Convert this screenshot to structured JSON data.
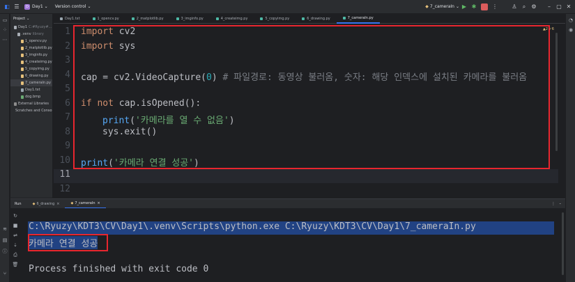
{
  "titlebar": {
    "project_badge": "D",
    "project_name": "Day1",
    "vcs": "Version control",
    "run_config": "7_cameraIn"
  },
  "project_panel": {
    "header": "Project",
    "items": [
      {
        "label": "Day1",
        "note": "C:#Ryuzy#...",
        "indent": 1,
        "icon": "folder-icon"
      },
      {
        "label": ".venv",
        "note": "library",
        "indent": 2,
        "icon": "folder-icon"
      },
      {
        "label": "1_opencv.py",
        "indent": 3,
        "icon": "python-file-icon"
      },
      {
        "label": "2_matplotlib.py",
        "indent": 3,
        "icon": "python-file-icon"
      },
      {
        "label": "3_imginfo.py",
        "indent": 3,
        "icon": "python-file-icon"
      },
      {
        "label": "4_createimg.py",
        "indent": 3,
        "icon": "python-file-icon"
      },
      {
        "label": "5_copyimg.py",
        "indent": 3,
        "icon": "python-file-icon"
      },
      {
        "label": "6_drawing.py",
        "indent": 3,
        "icon": "python-file-icon"
      },
      {
        "label": "7_cameraIn.py",
        "indent": 3,
        "icon": "python-file-icon",
        "selected": true
      },
      {
        "label": "Day1.txt",
        "indent": 3,
        "icon": "text-file-icon"
      },
      {
        "label": "dog.bmp",
        "indent": 3,
        "icon": "image-file-icon"
      },
      {
        "label": "External Libraries",
        "indent": 1,
        "icon": "library-icon"
      },
      {
        "label": "Scratches and Consoles",
        "indent": 1,
        "icon": "scratch-icon"
      }
    ]
  },
  "tabs": [
    {
      "label": "Day1.txt",
      "active": false
    },
    {
      "label": "1_opencv.py",
      "active": false
    },
    {
      "label": "2_matplotlib.py",
      "active": false
    },
    {
      "label": "3_imginfo.py",
      "active": false
    },
    {
      "label": "4_createimg.py",
      "active": false
    },
    {
      "label": "5_copyimg.py",
      "active": false
    },
    {
      "label": "6_drawing.py",
      "active": false
    },
    {
      "label": "7_cameraIn.py",
      "active": true
    }
  ],
  "editor": {
    "badge": "▲2 ✓6",
    "line_numbers": [
      "1",
      "2",
      "3",
      "4",
      "5",
      "6",
      "7",
      "8",
      "9",
      "10",
      "11",
      "12"
    ],
    "code": {
      "l1_kw": "import",
      "l1_rest": " cv2",
      "l2_kw": "import",
      "l2_rest": " sys",
      "l4_a": "cap = cv2.VideoCapture(",
      "l4_num": "0",
      "l4_b": ") ",
      "l4_cmt": "# 파일경로: 동영상 불러옴, 숫자: 해당 인덱스에 설치된 카메라를 불러옴",
      "l6_kw1": "if",
      "l6_kw2": " not",
      "l6_rest": " cap.isOpened():",
      "l7_fn": "print",
      "l7_a": "(",
      "l7_str": "'카메라를 열 수 없음'",
      "l7_b": ")",
      "l8": "sys.exit()",
      "l10_fn": "print",
      "l10_a": "(",
      "l10_str": "'카메라 연결 성공'",
      "l10_b": ")"
    }
  },
  "run_panel": {
    "label": "Run",
    "tabs": [
      {
        "label": "6_drawing",
        "active": false
      },
      {
        "label": "7_cameraIn",
        "active": true
      }
    ],
    "console": {
      "command": "C:\\Ryuzy\\KDT3\\CV\\Day1\\.venv\\Scripts\\python.exe C:\\Ryuzy\\KDT3\\CV\\Day1\\7_cameraIn.py",
      "output": "카메라 연결 성공",
      "exit": "Process finished with exit code 0"
    }
  },
  "colors": {
    "highlight_box": "#e8262f",
    "selection": "#214283",
    "keyword": "#cf8e6d",
    "string": "#6aab73"
  }
}
